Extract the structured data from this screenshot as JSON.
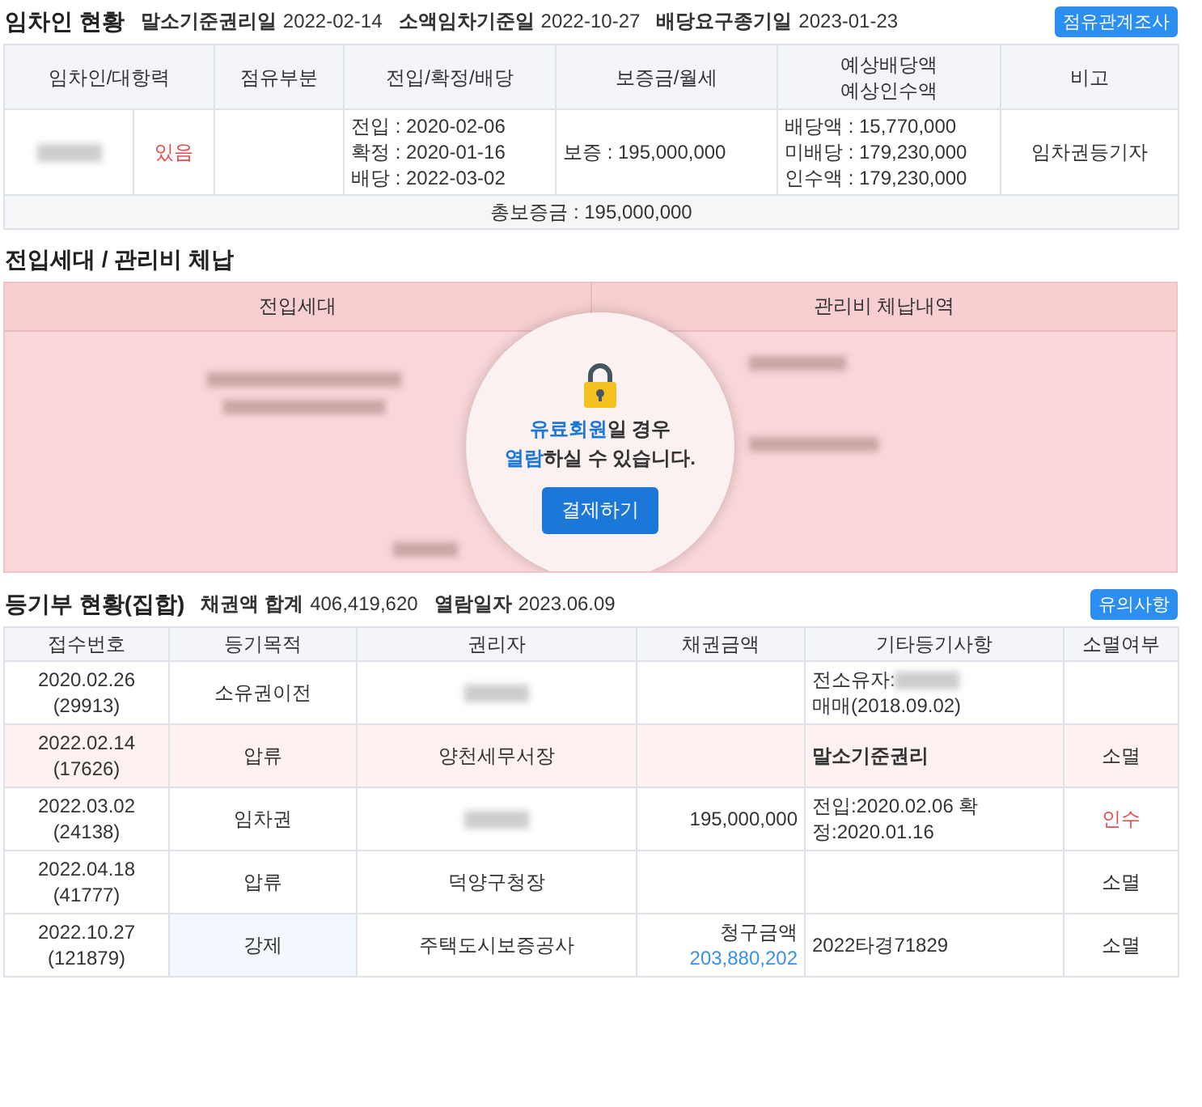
{
  "tenant_section": {
    "title": "임차인 현황",
    "facts": [
      {
        "label": "말소기준권리일",
        "value": "2022-02-14"
      },
      {
        "label": "소액임차기준일",
        "value": "2022-10-27"
      },
      {
        "label": "배당요구종기일",
        "value": "2023-01-23"
      }
    ],
    "button": "점유관계조사",
    "columns": [
      "임차인/대항력",
      "점유부분",
      "전입/확정/배당",
      "보증금/월세",
      "예상배당액\n예상인수액",
      "비고"
    ],
    "rows": [
      {
        "opposing": "있음",
        "opposing_alert": true,
        "dates": [
          "전입 : 2020-02-06",
          "확정 : 2020-01-16",
          "배당 : 2022-03-02"
        ],
        "deposit": "보증 : 195,000,000",
        "amounts": [
          "배당액 : 15,770,000",
          "미배당 : 179,230,000",
          "인수액 : 179,230,000"
        ],
        "note": "임차권등기자"
      }
    ],
    "total": "총보증금 : 195,000,000"
  },
  "household_section": {
    "title": "전입세대 / 관리비 체납",
    "columns": [
      "전입세대",
      "관리비 체납내역"
    ],
    "lock_message": [
      "**유료회원**일 경우",
      "**열람**하실 수 있습니다."
    ],
    "pay_button": "결제하기"
  },
  "registry_section": {
    "title": "등기부 현황(집합)",
    "facts": [
      {
        "label": "채권액 합계",
        "value": "406,419,620"
      },
      {
        "label": "열람일자",
        "value": "2023.06.09"
      }
    ],
    "button": "유의사항",
    "columns": [
      "접수번호",
      "등기목적",
      "권리자",
      "채권금액",
      "기타등기사항",
      "소멸여부"
    ],
    "rows": [
      {
        "date": "2020.02.26",
        "number": "(29913)",
        "purpose": "소유권이전",
        "holder_blurred": true,
        "note": "전소유자:",
        "note_blurred": true,
        "note_rest": "매매(2018.09.02)",
        "highlighted": false
      },
      {
        "date": "2022.02.14",
        "number": "(17626)",
        "purpose": "압류",
        "holder": "양천세무서장",
        "note": "말소기준권리",
        "note_bold": true,
        "status": "소멸",
        "highlighted": true
      },
      {
        "date": "2022.03.02",
        "number": "(24138)",
        "purpose": "임차권",
        "holder_blurred": true,
        "amount": "195,000,000",
        "note": "전입:2020.02.06 확정:2020.01.16",
        "status": "인수",
        "status_alert": true,
        "highlighted": false
      },
      {
        "date": "2022.04.18",
        "number": "(41777)",
        "purpose": "압류",
        "holder": "덕양구청장",
        "status": "소멸",
        "highlighted": false
      },
      {
        "date": "2022.10.27",
        "number": "(121879)",
        "purpose": "강제",
        "purpose_highlighted": true,
        "holder": "주택도시보증공사",
        "amount_label": "청구금액",
        "amount": "203,880,202",
        "note": "2022타경71829",
        "status": "소멸",
        "highlighted": false
      }
    ]
  }
}
